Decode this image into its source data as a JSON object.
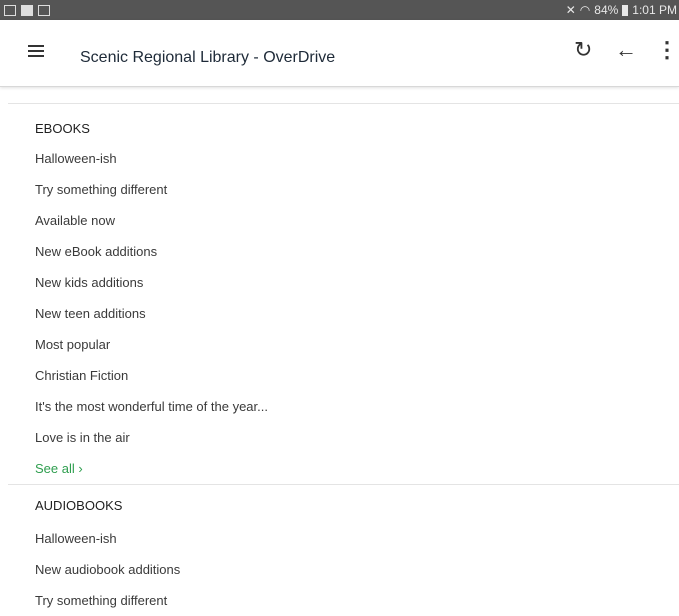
{
  "status_bar": {
    "battery": "84%",
    "time": "1:01 PM"
  },
  "app_bar": {
    "title": "Scenic Regional Library - OverDrive"
  },
  "ebooks": {
    "header": "EBOOKS",
    "items": [
      "Halloween-ish",
      "Try something different",
      "Available now",
      "New eBook additions",
      "New kids additions",
      "New teen additions",
      "Most popular",
      "Christian Fiction",
      "It's the most wonderful time of the year...",
      "Love is in the air"
    ],
    "see_all": "See all ›"
  },
  "audiobooks": {
    "header": "AUDIOBOOKS",
    "items": [
      "Halloween-ish",
      "New audiobook additions",
      "Try something different"
    ]
  },
  "icons": {
    "menu": "hamburger-menu-icon",
    "refresh": "refresh-icon",
    "back": "back-arrow-icon",
    "more": "more-vertical-icon"
  }
}
